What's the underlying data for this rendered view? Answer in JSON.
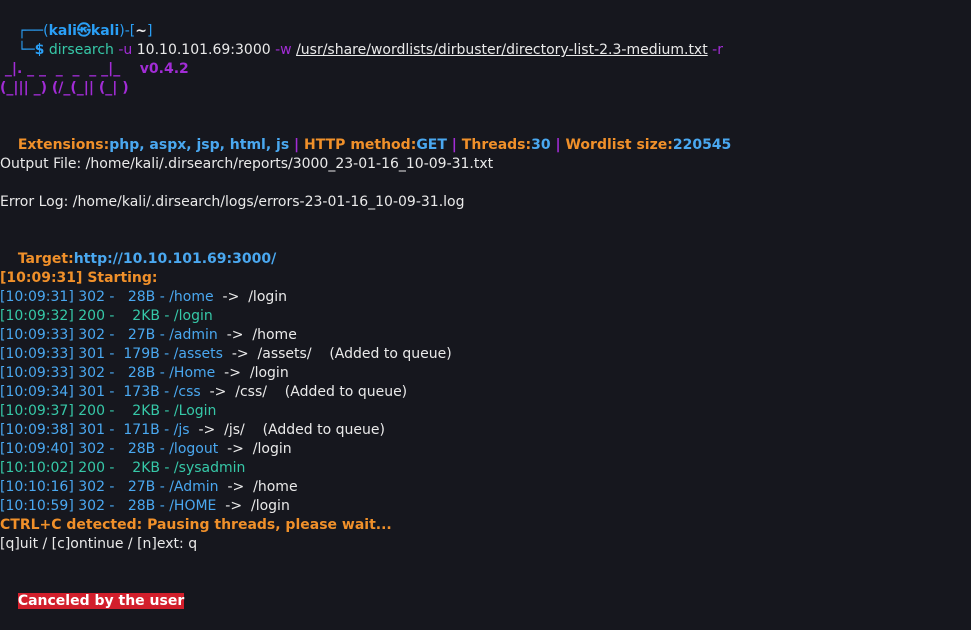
{
  "prompt": {
    "corner_top": "┌──(",
    "user": "kali㉿",
    "host": "kali",
    "mid": ")-[",
    "dir": "~",
    "close": "]",
    "corner_bottom": "└─",
    "dollar": "$",
    "command": "dirsearch",
    "flag_u": "-u",
    "target_arg": "10.10.101.69:3000",
    "flag_w": "-w",
    "wordlist_arg": "/usr/share/wordlists/dirbuster/directory-list-2.3-medium.txt",
    "flag_r": "-r"
  },
  "banner": {
    "line1": " _|. _ _  _  _  _ _|_    v0.4.2",
    "line2": "(_||| _) (/_(_|| (_| )"
  },
  "config": {
    "ext_label": "Extensions:",
    "ext_value": "php, aspx, jsp, html, js",
    "sep1": " | ",
    "method_label": "HTTP method:",
    "method_value": "GET",
    "sep2": " | ",
    "threads_label": "Threads:",
    "threads_value": "30",
    "sep3": " | ",
    "wordlist_label": "Wordlist size:",
    "wordlist_value": "220545"
  },
  "output_file": "Output File: /home/kali/.dirsearch/reports/3000_23-01-16_10-09-31.txt",
  "error_log": "Error Log: /home/kali/.dirsearch/logs/errors-23-01-16_10-09-31.log",
  "target": {
    "label": "Target:",
    "value": "http://10.10.101.69:3000/"
  },
  "starting": "[10:09:31] Starting:",
  "results": [
    {
      "time": "[10:09:31]",
      "status": "302",
      "size": "  28B",
      "path": "/home",
      "redirect": "/login",
      "note": ""
    },
    {
      "time": "[10:09:32]",
      "status": "200",
      "size": "   2KB",
      "path": "/login",
      "redirect": "",
      "note": ""
    },
    {
      "time": "[10:09:33]",
      "status": "302",
      "size": "  27B",
      "path": "/admin",
      "redirect": "/home",
      "note": ""
    },
    {
      "time": "[10:09:33]",
      "status": "301",
      "size": " 179B",
      "path": "/assets",
      "redirect": "/assets/",
      "note": "(Added to queue)"
    },
    {
      "time": "[10:09:33]",
      "status": "302",
      "size": "  28B",
      "path": "/Home",
      "redirect": "/login",
      "note": ""
    },
    {
      "time": "[10:09:34]",
      "status": "301",
      "size": " 173B",
      "path": "/css",
      "redirect": "/css/",
      "note": "(Added to queue)"
    },
    {
      "time": "[10:09:37]",
      "status": "200",
      "size": "   2KB",
      "path": "/Login",
      "redirect": "",
      "note": ""
    },
    {
      "time": "[10:09:38]",
      "status": "301",
      "size": " 171B",
      "path": "/js",
      "redirect": "/js/",
      "note": "(Added to queue)"
    },
    {
      "time": "[10:09:40]",
      "status": "302",
      "size": "  28B",
      "path": "/logout",
      "redirect": "/login",
      "note": ""
    },
    {
      "time": "[10:10:02]",
      "status": "200",
      "size": "   2KB",
      "path": "/sysadmin",
      "redirect": "",
      "note": ""
    },
    {
      "time": "[10:10:16]",
      "status": "302",
      "size": "  27B",
      "path": "/Admin",
      "redirect": "/home",
      "note": ""
    },
    {
      "time": "[10:10:59]",
      "status": "302",
      "size": "  28B",
      "path": "/HOME",
      "redirect": "/login",
      "note": ""
    }
  ],
  "ctrl_c": "CTRL+C detected: Pausing threads, please wait...",
  "pause_prompt": "[q]uit / [c]ontinue / [n]ext: q",
  "canceled": "Canceled by the user",
  "colors": {
    "background": "#16171e",
    "prompt_blue": "#2a9ff6",
    "banner_purple": "#a22cd6",
    "config_orange": "#f0902a",
    "status_200_teal": "#36c8a8",
    "status_3xx_blue": "#4aa8f0",
    "cancel_red": "#d21f2c"
  }
}
